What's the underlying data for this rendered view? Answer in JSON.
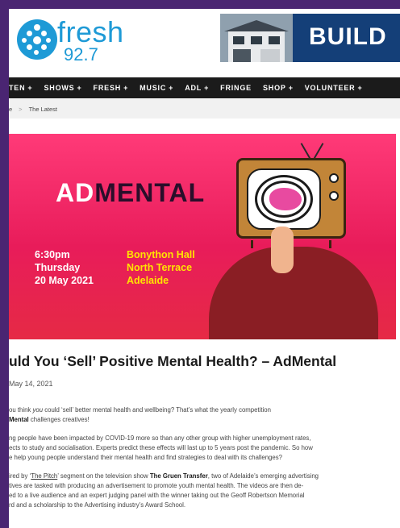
{
  "site": {
    "logo_word": "fresh",
    "logo_freq": "92.7",
    "accent_color": "#1e9ad6",
    "ad_text": "BUILD"
  },
  "nav": {
    "items": [
      {
        "label": "TEN",
        "has_plus": true
      },
      {
        "label": "SHOWS",
        "has_plus": true
      },
      {
        "label": "FRESH",
        "has_plus": true
      },
      {
        "label": "MUSIC",
        "has_plus": true
      },
      {
        "label": "ADL",
        "has_plus": true
      },
      {
        "label": "FRINGE",
        "has_plus": false
      },
      {
        "label": "SHOP",
        "has_plus": true
      },
      {
        "label": "VOLUNTEER",
        "has_plus": true
      }
    ],
    "plus_symbol": "+"
  },
  "breadcrumb": {
    "home": "e",
    "separator": ">",
    "current": "The Latest"
  },
  "hero": {
    "brand_ad": "AD",
    "brand_mental": "MENTAL",
    "time": "6:30pm",
    "day": "Thursday",
    "date": "20 May 2021",
    "venue_line1": "Bonython Hall",
    "venue_line2": "North Terrace",
    "venue_line3": "Adelaide"
  },
  "article": {
    "title": "uld You ‘Sell’ Positive Mental Health? – AdMental",
    "date": "May 14, 2021",
    "p1_pre": "ou think ",
    "p1_you": "you",
    "p1_post": " could ‘sell’ better mental health and wellbeing? That’s what the yearly competition",
    "p1b_bold": "Mental",
    "p1b_rest": " challenges creatives!",
    "p2_l1": "ng people have been impacted by COVID-19 more so than any other group with higher unemployment rates,",
    "p2_l2": "ects to study and socialisation. Experts predict these effects will last up to 5 years post the pandemic. So how",
    "p2_l3": "e help young people understand their mental health and find strategies to deal with its challenges?",
    "p3_pre": "ired by ‘",
    "p3_link": "The Pitch",
    "p3_mid": "’ segment on the television show ",
    "p3_bold": "The Gruen Transfer",
    "p3_post": ", two of Adelaide’s emerging advertising",
    "p3_l2": "tives are tasked with producing an advertisement to promote youth mental health. The videos are then de-",
    "p3_l3": "ed to a live audience and an expert judging panel with the winner taking out the Geoff Robertson Memorial",
    "p3_l4": "rd and a scholarship to the Advertising industry’s Award School."
  }
}
